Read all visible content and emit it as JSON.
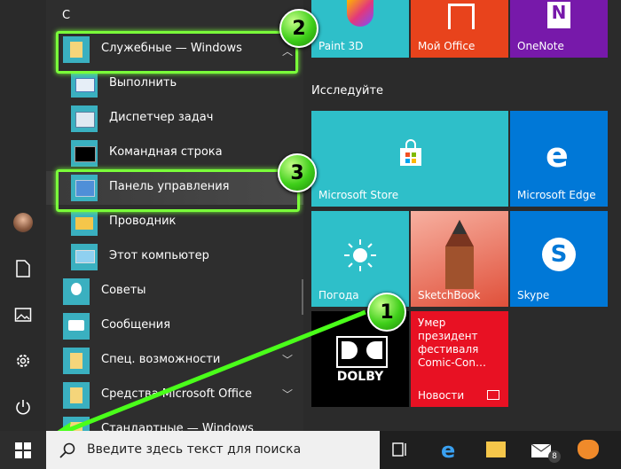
{
  "applist": {
    "section_letter": "С",
    "items": [
      {
        "label": "Служебные — Windows"
      },
      {
        "label": "Выполнить"
      },
      {
        "label": "Диспетчер задач"
      },
      {
        "label": "Командная строка"
      },
      {
        "label": "Панель управления"
      },
      {
        "label": "Проводник"
      },
      {
        "label": "Этот компьютер"
      },
      {
        "label": "Советы"
      },
      {
        "label": "Сообщения"
      },
      {
        "label": "Спец. возможности"
      },
      {
        "label": "Средства Microsoft Office"
      },
      {
        "label": "Стандартные — Windows"
      }
    ]
  },
  "tiles": {
    "group_label": "Исследуйте",
    "paint3d": "Paint 3D",
    "myoffice": "Мой Office",
    "onenote": "OneNote",
    "store": "Microsoft Store",
    "edge": "Microsoft Edge",
    "weather": "Погода",
    "sketchbook": "SketchBook",
    "skype": "Skype",
    "dolby": "DOLBY",
    "news_headline": "Умер президент фестиваля Comic-Con…",
    "news": "Новости"
  },
  "annotations": {
    "step1": "1",
    "step2": "2",
    "step3": "3"
  },
  "taskbar": {
    "search_placeholder": "Введите здесь текст для поиска",
    "mail_badge": "8"
  },
  "colors": {
    "highlight": "#7aff3a",
    "tile_teal": "#2ebfc9",
    "tile_blue": "#0078d7",
    "tile_red": "#e81123",
    "tile_purple": "#7719aa"
  }
}
